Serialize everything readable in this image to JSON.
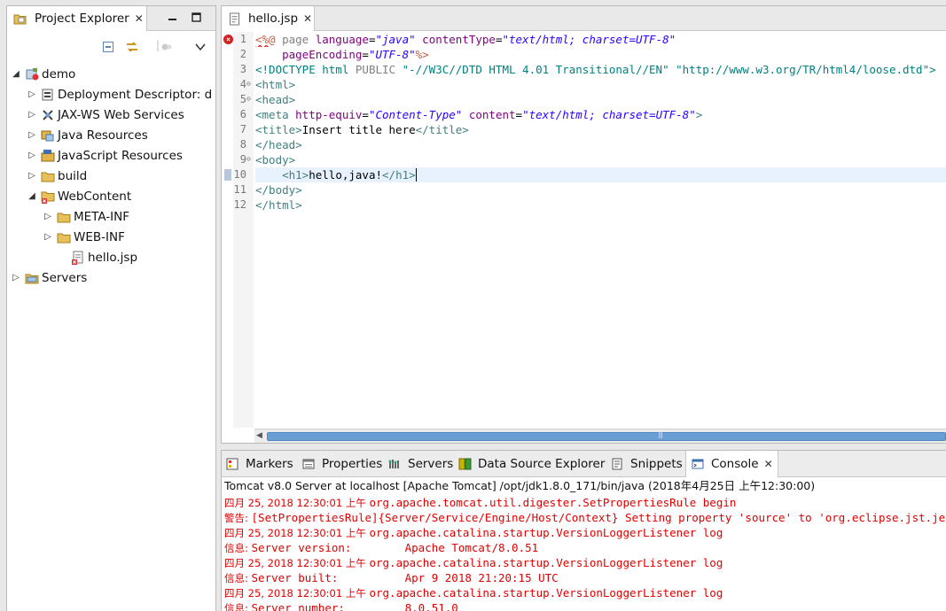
{
  "explorer": {
    "title": "Project Explorer",
    "tree": [
      {
        "label": "demo",
        "expanded": true,
        "icon": "web-project-icon"
      },
      {
        "label": "Deployment Descriptor: d",
        "expanded": false,
        "icon": "deployment-descriptor-icon"
      },
      {
        "label": "JAX-WS Web Services",
        "expanded": false,
        "icon": "webservices-icon"
      },
      {
        "label": "Java Resources",
        "expanded": false,
        "icon": "java-resources-icon"
      },
      {
        "label": "JavaScript Resources",
        "expanded": false,
        "icon": "javascript-resources-icon"
      },
      {
        "label": "build",
        "expanded": false,
        "icon": "folder-icon"
      },
      {
        "label": "WebContent",
        "expanded": true,
        "icon": "folder-error-icon"
      },
      {
        "label": "META-INF",
        "expanded": false,
        "icon": "folder-icon"
      },
      {
        "label": "WEB-INF",
        "expanded": false,
        "icon": "folder-icon"
      },
      {
        "label": "hello.jsp",
        "expanded": null,
        "icon": "jsp-file-error-icon"
      },
      {
        "label": "Servers",
        "expanded": false,
        "icon": "servers-folder-icon"
      }
    ]
  },
  "editor": {
    "tab_label": "hello.jsp",
    "line_numbers": [
      "1",
      "2",
      "3",
      "4",
      "5",
      "6",
      "7",
      "8",
      "9",
      "10",
      "11",
      "12"
    ],
    "code": {
      "l1_a": "<%@",
      "l1_b": " page ",
      "l1_c": "language",
      "l1_d": "=",
      "l1_e": "\"java\"",
      "l1_f": " contentType",
      "l1_g": "=",
      "l1_h": "\"text/html; charset=UTF-8\"",
      "l2_a": "    pageEncoding",
      "l2_b": "=",
      "l2_c": "\"UTF-8\"",
      "l2_d": "%>",
      "l3_a": "<!DOCTYPE html ",
      "l3_b": "PUBLIC ",
      "l3_c": "\"-//W3C//DTD HTML 4.01 Transitional//EN\" \"http://www.w3.org/TR/html4/loose.dtd\"",
      "l3_d": ">",
      "l4": "<html>",
      "l5": "<head>",
      "l6_a": "<meta ",
      "l6_b": "http-equiv",
      "l6_c": "=",
      "l6_d": "\"Content-Type\"",
      "l6_e": " content",
      "l6_f": "=",
      "l6_g": "\"text/html; charset=UTF-8\"",
      "l6_h": ">",
      "l7_a": "<title>",
      "l7_b": "Insert title here",
      "l7_c": "</title>",
      "l8": "</head>",
      "l9": "<body>",
      "l10_a": "    <h1>",
      "l10_b": "hello,java!",
      "l10_c": "</h1>",
      "l11": "</body>",
      "l12": "</html>"
    }
  },
  "bottom": {
    "tabs": {
      "markers": "Markers",
      "properties": "Properties",
      "servers": "Servers",
      "datasource": "Data Source Explorer",
      "snippets": "Snippets",
      "console": "Console"
    },
    "console_title": "Tomcat v8.0 Server at localhost [Apache Tomcat] /opt/jdk1.8.0_171/bin/java (2018年4月25日 上午12:30:00)",
    "lines": [
      {
        "prefix": "四月 25, 2018 12:30:01 上午 ",
        "text": "org.apache.tomcat.util.digester.SetPropertiesRule begin"
      },
      {
        "prefix": "警告: ",
        "text": "[SetPropertiesRule]{Server/Service/Engine/Host/Context} Setting property 'source' to 'org.eclipse.jst.jee.server:demo'"
      },
      {
        "prefix": "四月 25, 2018 12:30:01 上午 ",
        "text": "org.apache.catalina.startup.VersionLoggerListener log"
      },
      {
        "prefix": "信息: ",
        "text": "Server version:        Apache Tomcat/8.0.51"
      },
      {
        "prefix": "四月 25, 2018 12:30:01 上午 ",
        "text": "org.apache.catalina.startup.VersionLoggerListener log"
      },
      {
        "prefix": "信息: ",
        "text": "Server built:          Apr 9 2018 21:20:15 UTC"
      },
      {
        "prefix": "四月 25, 2018 12:30:01 上午 ",
        "text": "org.apache.catalina.startup.VersionLoggerListener log"
      },
      {
        "prefix": "信息: ",
        "text": "Server number:         8.0.51.0"
      }
    ]
  },
  "colors": {
    "tag": "#3f7f7f",
    "attribute": "#7f007f",
    "value": "#2a00ff",
    "console_error": "#e00000",
    "current_line": "#e8f2fe"
  }
}
